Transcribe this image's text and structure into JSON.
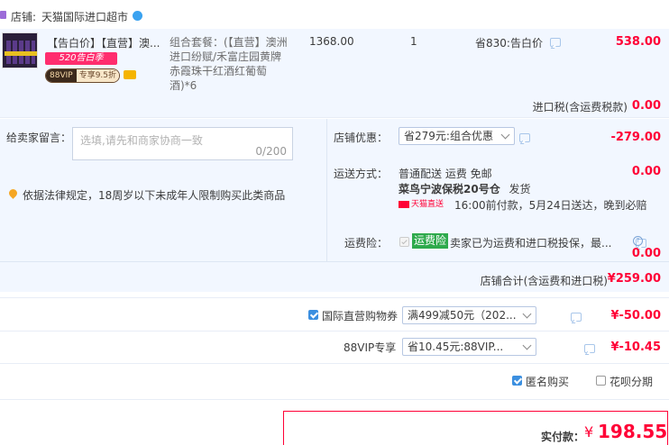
{
  "shop": {
    "label": "店铺:",
    "name": "天猫国际进口超市"
  },
  "item": {
    "tag1": "【告白价】",
    "tag2": "【直营】",
    "title_short": "澳...",
    "promo_badge": "520告白季",
    "vip_badge": "88VIP",
    "vip_text": "专享9.5折",
    "sku": "组合套餐：(【直营】澳洲进口纷赋/禾富庄园黄牌赤霞珠干红酒红葡萄酒)*6",
    "unit_price": "1368.00",
    "qty": "1",
    "discount": "省830:告白价",
    "subtotal": "538.00"
  },
  "import_tax": {
    "label": "进口税(含运费税款)",
    "value": "0.00"
  },
  "message": {
    "label": "给卖家留言：",
    "placeholder": "选填,请先和商家协商一致",
    "counter": "0/200"
  },
  "legal_notice": "依据法律规定，18周岁以下未成年人限制购买此类商品",
  "shop_discount": {
    "label": "店铺优惠：",
    "selected": "省279元:组合优惠",
    "value": "-279.00"
  },
  "shipping": {
    "label": "运送方式：",
    "method": "普通配送 运费 免邮",
    "value": "0.00",
    "warehouse": "菜鸟宁波保税20号仓",
    "warehouse_suffix": "发货",
    "express_badge": "天猫直送",
    "eta": "16:00前付款，5月24日送达，晚到必赔"
  },
  "insurance": {
    "label": "运费险：",
    "badge": "运费险",
    "text": "卖家已为运费和进口税投保，最...",
    "value": "0.00"
  },
  "shop_total": {
    "label": "店铺合计(含运费和进口税)",
    "value": "¥259.00"
  },
  "coupon": {
    "label": "国际直营购物券",
    "selected": "满499减50元（202...",
    "value": "¥-50.00"
  },
  "vip_discount": {
    "label": "88VIP专享",
    "selected": "省10.45元:88VIP...",
    "value": "¥-10.45"
  },
  "options": {
    "anonymous": "匿名购买",
    "huabei": "花呗分期"
  },
  "payment": {
    "label": "实付款：",
    "currency": "¥",
    "amount": "198.55"
  },
  "colors": {
    "accent_red": "#ff0036",
    "panel_blue": "#f2f7ff",
    "check_blue": "#3b8fe0"
  }
}
